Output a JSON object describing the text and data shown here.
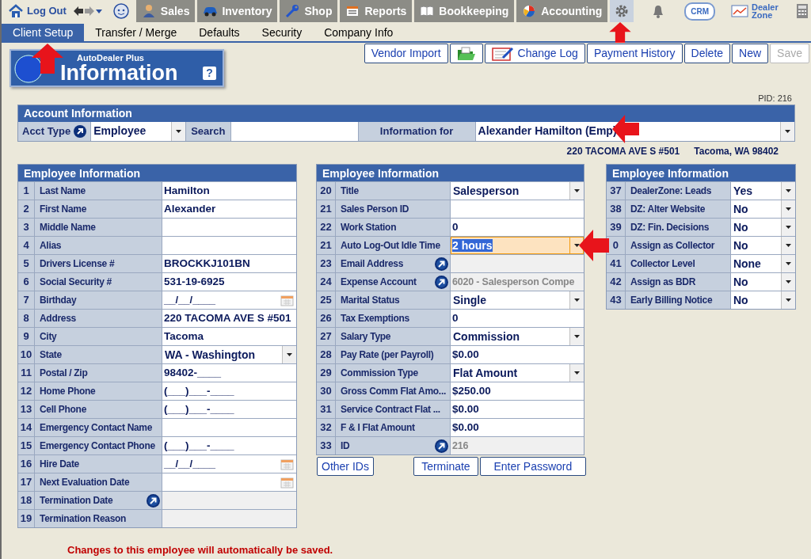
{
  "nav": {
    "logout": "Log Out",
    "tabs": [
      {
        "label": "Sales"
      },
      {
        "label": "Inventory"
      },
      {
        "label": "Shop"
      },
      {
        "label": "Reports"
      },
      {
        "label": "Bookkeeping"
      },
      {
        "label": "Accounting"
      }
    ],
    "settings": {
      "selected": true
    },
    "crm": "CRM",
    "dealer_zone": "Dealer Zone"
  },
  "subtabs": [
    {
      "label": "Client Setup",
      "selected": true
    },
    {
      "label": "Transfer / Merge",
      "selected": false
    },
    {
      "label": "Defaults",
      "selected": false
    },
    {
      "label": "Security",
      "selected": false
    },
    {
      "label": "Company Info",
      "selected": false
    }
  ],
  "header": {
    "product": "AutoDealer Plus",
    "title": "Information",
    "help": "?"
  },
  "toolbar": [
    {
      "kind": "text",
      "label": "Vendor Import",
      "disabled": false
    },
    {
      "kind": "icon",
      "disabled": false
    },
    {
      "kind": "icon_text",
      "label": "Change Log",
      "disabled": false
    },
    {
      "kind": "text",
      "label": "Payment History",
      "disabled": false
    },
    {
      "kind": "text",
      "label": "Delete",
      "disabled": false
    },
    {
      "kind": "text",
      "label": "New",
      "disabled": false
    },
    {
      "kind": "text",
      "label": "Save",
      "disabled": true
    }
  ],
  "pid": "PID: 216",
  "account": {
    "title": "Account Information",
    "acct_type_label": "Acct Type",
    "acct_type": "Employee",
    "search_label": "Search",
    "info_for_label": "Information for",
    "info_for": "Alexander Hamilton (Emp)"
  },
  "address": [
    "220 TACOMA AVE S #501",
    "Tacoma, WA 98402"
  ],
  "panels": [
    {
      "title": "Employee Information",
      "rows": [
        {
          "num": "1",
          "label": "Last Name",
          "kind": "text",
          "value": "Hamilton"
        },
        {
          "num": "2",
          "label": "First Name",
          "kind": "text",
          "value": "Alexander"
        },
        {
          "num": "3",
          "label": "Middle Name",
          "kind": "text"
        },
        {
          "num": "4",
          "label": "Alias",
          "kind": "text"
        },
        {
          "num": "5",
          "label": "Drivers License #",
          "kind": "text",
          "value": "BROCKKJ101BN"
        },
        {
          "num": "6",
          "label": "Social Security #",
          "kind": "text",
          "value": "531-19-6925"
        },
        {
          "num": "7",
          "label": "Birthday",
          "kind": "date",
          "value": "__/__/____"
        },
        {
          "num": "8",
          "label": "Address",
          "kind": "text",
          "value": "220 TACOMA AVE S #501"
        },
        {
          "num": "9",
          "label": "City",
          "kind": "text",
          "value": "Tacoma"
        },
        {
          "num": "10",
          "label": "State",
          "kind": "select",
          "value": "WA - Washington"
        },
        {
          "num": "11",
          "label": "Postal / Zip",
          "kind": "text",
          "value": "98402-____"
        },
        {
          "num": "12",
          "label": "Home Phone",
          "kind": "text",
          "value": "(___)___-____"
        },
        {
          "num": "13",
          "label": "Cell Phone",
          "kind": "text",
          "value": "(___)___-____"
        },
        {
          "num": "14",
          "label": "Emergency Contact Name",
          "kind": "text"
        },
        {
          "num": "15",
          "label": "Emergency Contact Phone",
          "kind": "text",
          "value": "(___)___-____"
        },
        {
          "num": "16",
          "label": "Hire Date",
          "kind": "date",
          "value": "__/__/____"
        },
        {
          "num": "17",
          "label": "Next Evaluation Date",
          "kind": "date"
        },
        {
          "num": "18",
          "label": "Termination Date",
          "kind": "readonly",
          "link": true
        },
        {
          "num": "19",
          "label": "Termination Reason",
          "kind": "readonly"
        }
      ]
    },
    {
      "title": "Employee Information",
      "rows": [
        {
          "num": "20",
          "label": "Title",
          "kind": "select",
          "value": "Salesperson"
        },
        {
          "num": "21",
          "label": "Sales Person ID",
          "kind": "text"
        },
        {
          "num": "22",
          "label": "Work Station",
          "kind": "text",
          "value": "0"
        },
        {
          "num": "21",
          "label": "Auto Log-Out Idle Time",
          "kind": "select",
          "value": "2 hours",
          "focused": true
        },
        {
          "num": "23",
          "label": "Email Address",
          "kind": "readonly",
          "link": true
        },
        {
          "num": "24",
          "label": "Expense Account",
          "kind": "readonly",
          "link": true,
          "value": "6020 - Salesperson Compe"
        },
        {
          "num": "25",
          "label": "Marital Status",
          "kind": "select",
          "value": "Single"
        },
        {
          "num": "26",
          "label": "Tax Exemptions",
          "kind": "text",
          "value": "0"
        },
        {
          "num": "27",
          "label": "Salary Type",
          "kind": "select",
          "value": "Commission"
        },
        {
          "num": "28",
          "label": "Pay Rate (per Payroll)",
          "kind": "text",
          "value": "$0.00"
        },
        {
          "num": "29",
          "label": "Commission Type",
          "kind": "select",
          "value": "Flat Amount"
        },
        {
          "num": "30",
          "label": "Gross Comm Flat Amo...",
          "kind": "text",
          "value": "$250.00"
        },
        {
          "num": "31",
          "label": "Service Contract Flat ...",
          "kind": "text",
          "value": "$0.00"
        },
        {
          "num": "32",
          "label": "F & I Flat Amount",
          "kind": "text",
          "value": "$0.00"
        },
        {
          "num": "33",
          "label": "ID",
          "kind": "readonly",
          "link": true,
          "value": "216"
        }
      ],
      "buttons": [
        "Other IDs",
        "Terminate",
        "Enter Password"
      ]
    },
    {
      "title": "Employee Information",
      "rows": [
        {
          "num": "37",
          "label": "DealerZone:  Leads",
          "kind": "select",
          "value": "Yes"
        },
        {
          "num": "38",
          "label": "DZ: Alter Website",
          "kind": "select",
          "value": "No"
        },
        {
          "num": "39",
          "label": "DZ:  Fin. Decisions",
          "kind": "select",
          "value": "No"
        },
        {
          "num": "0",
          "label": "Assign as Collector",
          "kind": "select",
          "value": "No"
        },
        {
          "num": "41",
          "label": "Collector Level",
          "kind": "select",
          "value": "None"
        },
        {
          "num": "42",
          "label": "Assign as BDR",
          "kind": "select",
          "value": "No"
        },
        {
          "num": "43",
          "label": "Early Billing Notice",
          "kind": "select",
          "value": "No"
        }
      ]
    }
  ],
  "footer": "Changes to this employee will automatically be saved."
}
